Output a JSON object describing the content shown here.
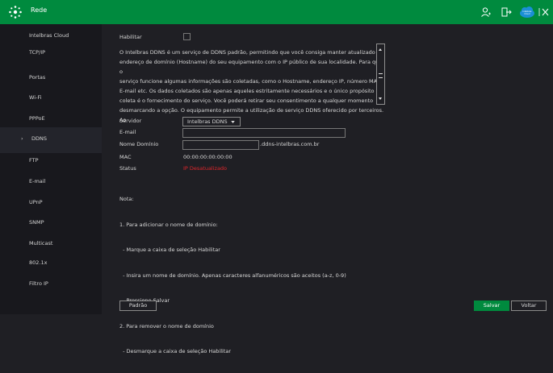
{
  "header": {
    "title": "Rede",
    "cloud_badge": "Intelbras Cloud"
  },
  "sidebar": {
    "items": [
      {
        "label": "Intelbras Cloud"
      },
      {
        "label": "TCP/IP"
      },
      {
        "label": "Portas"
      },
      {
        "label": "Wi-Fi"
      },
      {
        "label": "PPPoE"
      },
      {
        "label": "DDNS",
        "active": true,
        "marker": "›"
      },
      {
        "label": "FTP"
      },
      {
        "label": "E-mail"
      },
      {
        "label": "UPnP"
      },
      {
        "label": "SNMP"
      },
      {
        "label": "Multicast"
      },
      {
        "label": "802.1x"
      },
      {
        "label": "Filtro IP"
      }
    ]
  },
  "ddns": {
    "enable_label": "Habilitar",
    "description": [
      "O Intelbras DDNS é um serviço de DDNS padrão, permitindo que você consiga manter atualizado o",
      "endereço de domínio (Hostname) do seu equipamento com o IP público de sua localidade. Para que o",
      "serviço funcione algumas informações são coletadas, como o Hostname, endereço IP, número MAC,",
      "E-mail etc. Os dados coletados são apenas aqueles estritamente necessários e o único propósito da",
      "coleta é o fornecimento do serviço. Você poderá retirar seu consentimento a qualquer momento",
      "desmarcando a opção. O equipamento permite a utilização de serviço DDNS oferecido por terceiros. Ao"
    ],
    "server_label": "Servidor",
    "server_value": "Intelbras DDNS",
    "email_label": "E-mail",
    "email_value": "",
    "domain_label": "Nome Domínio",
    "domain_value": "",
    "domain_suffix": ".ddns-intelbras.com.br",
    "mac_label": "MAC",
    "mac_value": "00:00:00:00:00:00",
    "status_label": "Status",
    "status_value": "IP Desatualizado",
    "status_color": "#e0262b",
    "notes": [
      "Nota:",
      "1. Para adicionar o nome de domínio:",
      "  - Marque a caixa de seleção Habilitar",
      "  - Insira um nome de domínio. Apenas caracteres alfanuméricos são aceitos (a-z, 0-9)",
      "  - Pressione Salvar",
      "2. Para remover o nome de domínio",
      "  - Desmarque a caixa de seleção Habilitar"
    ]
  },
  "footer": {
    "default_label": "Padrão",
    "save_label": "Salvar",
    "back_label": "Voltar"
  },
  "colors": {
    "accent": "#008a3e",
    "background": "#1f1f24",
    "sidebar": "#18181d"
  },
  "icons": [
    "network-icon",
    "user-icon",
    "logout-icon",
    "cloud-icon",
    "close-icon",
    "chevron-down-icon"
  ]
}
